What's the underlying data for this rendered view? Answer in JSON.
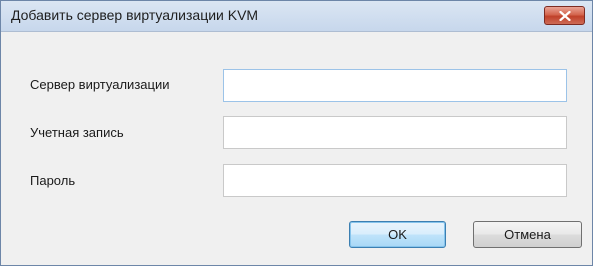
{
  "window": {
    "title": "Добавить сервер виртуализации KVM"
  },
  "icons": {
    "close": "close-icon"
  },
  "form": {
    "server_label": "Сервер виртуализации",
    "server_value": "",
    "account_label": "Учетная запись",
    "account_value": "",
    "password_label": "Пароль",
    "password_value": ""
  },
  "buttons": {
    "ok_label": "OK",
    "cancel_label": "Отмена"
  },
  "colors": {
    "close_button": "#c9513b",
    "default_button_border": "#3c7fb1",
    "focused_field_border": "#9cc3e8"
  }
}
